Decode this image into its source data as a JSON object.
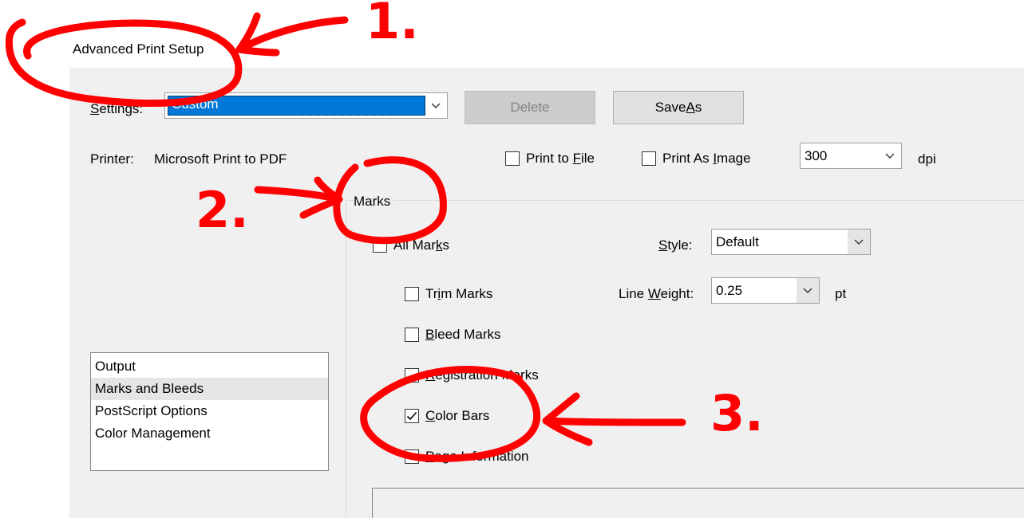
{
  "window": {
    "title": "Advanced Print Setup"
  },
  "settings": {
    "label": "Settings:",
    "value": "Custom",
    "delete_label": "Delete",
    "save_as_label": "Save As"
  },
  "printer": {
    "label": "Printer:",
    "name": "Microsoft Print to PDF",
    "print_to_file_label": "Print to File",
    "print_to_file_checked": false,
    "print_as_image_label": "Print As Image",
    "print_as_image_checked": false,
    "dpi_value": "300",
    "dpi_unit": "dpi"
  },
  "marks": {
    "section_title": "Marks",
    "all_marks_label": "All Marks",
    "all_marks_checked": false,
    "style_label": "Style:",
    "style_value": "Default",
    "line_weight_label": "Line Weight:",
    "line_weight_value": "0.25",
    "line_weight_unit": "pt",
    "items": [
      {
        "label": "Trim Marks",
        "checked": false
      },
      {
        "label": "Bleed Marks",
        "checked": false
      },
      {
        "label": "Registration Marks",
        "checked": false
      },
      {
        "label": "Color Bars",
        "checked": true
      },
      {
        "label": "Page Information",
        "checked": false
      }
    ]
  },
  "sidebar": {
    "items": [
      {
        "label": "Output",
        "selected": false
      },
      {
        "label": "Marks and Bleeds",
        "selected": true
      },
      {
        "label": "PostScript Options",
        "selected": false
      },
      {
        "label": "Color Management",
        "selected": false
      }
    ]
  },
  "annotations": [
    {
      "label": "1."
    },
    {
      "label": "2."
    },
    {
      "label": "3."
    }
  ],
  "colors": {
    "selection": "#0078d7",
    "annotation": "#ff0000",
    "panel": "#f0f0f0"
  }
}
